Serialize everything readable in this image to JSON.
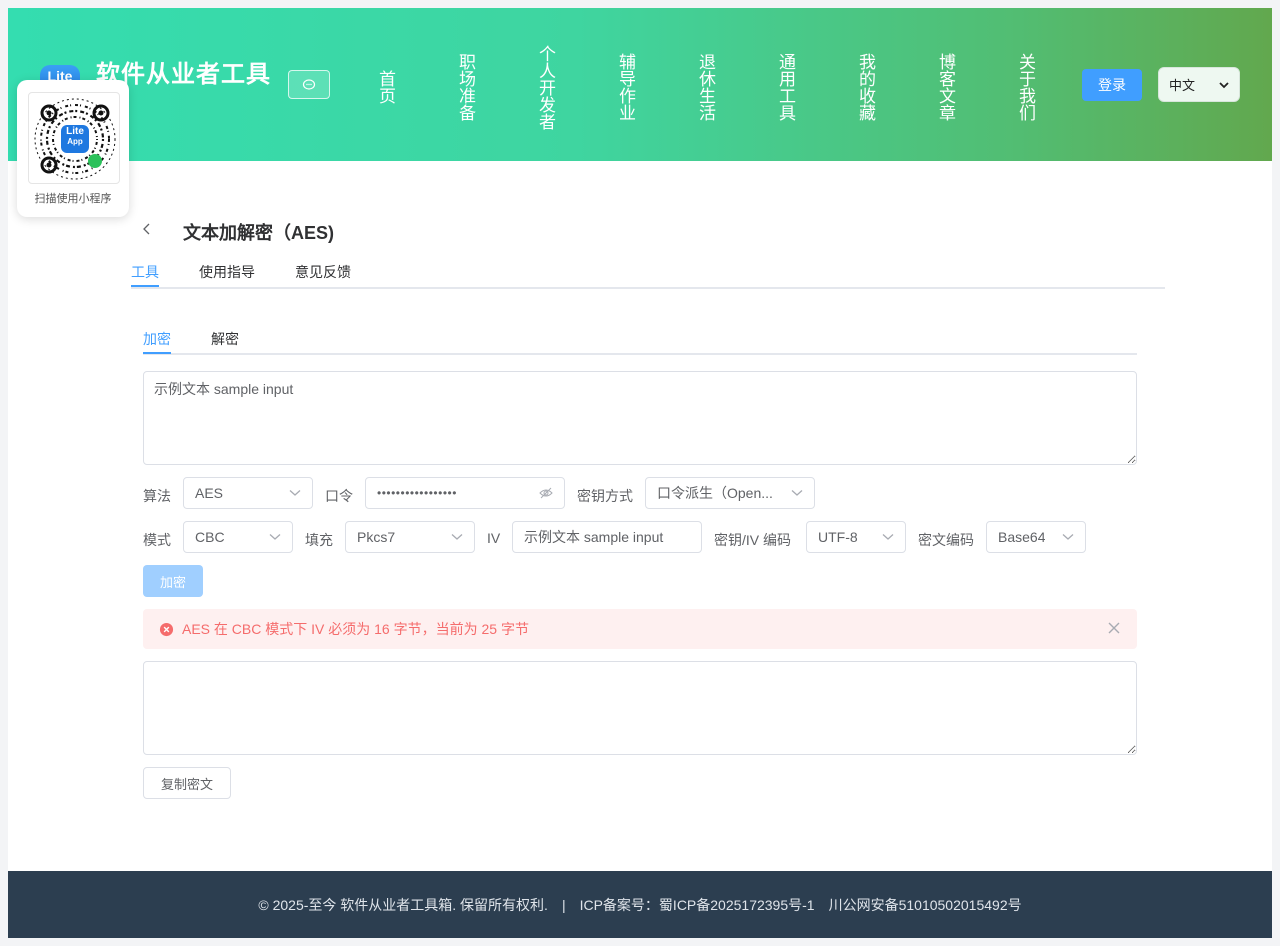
{
  "header": {
    "logo_text": "Lite",
    "site_title": "软件从业者工具",
    "nav": [
      "首页",
      "职场准备",
      "个人开发者",
      "辅导作业",
      "退休生活",
      "通用工具",
      "我的收藏",
      "博客文章",
      "关于我们"
    ],
    "login_label": "登录",
    "language": "中文"
  },
  "qr": {
    "badge_line1": "Lite",
    "badge_line2": "App",
    "caption": "扫描使用小程序"
  },
  "tool": {
    "title": "文本加解密（AES)",
    "tabs": [
      "工具",
      "使用指导",
      "意见反馈"
    ]
  },
  "panel": {
    "sub_tabs": [
      "加密",
      "解密"
    ],
    "input_text": "示例文本 sample input",
    "algorithm_label": "算法",
    "algorithm_value": "AES",
    "password_label": "口令",
    "password_value": "•••••••••••••••••",
    "key_method_label": "密钥方式",
    "key_method_value": "口令派生（Open...",
    "mode_label": "模式",
    "mode_value": "CBC",
    "padding_label": "填充",
    "padding_value": "Pkcs7",
    "iv_label": "IV",
    "iv_value": "示例文本 sample input",
    "key_encoding_label": "密钥/IV 编码",
    "key_encoding_value": "UTF-8",
    "cipher_encoding_label": "密文编码",
    "cipher_encoding_value": "Base64",
    "encrypt_button": "加密",
    "error_message": "AES 在 CBC 模式下 IV 必须为 16 字节，当前为 25 字节",
    "output_text": "",
    "copy_button": "复制密文"
  },
  "footer": {
    "copyright": "© 2025-至今 软件从业者工具箱. 保留所有权利.",
    "separator": "|",
    "icp": "ICP备案号：蜀ICP备2025172395号-1",
    "police": "川公网安备51010502015492号"
  },
  "colors": {
    "accent": "#409eff",
    "error": "#f56c6c",
    "footer_bg": "#2c3e50"
  }
}
